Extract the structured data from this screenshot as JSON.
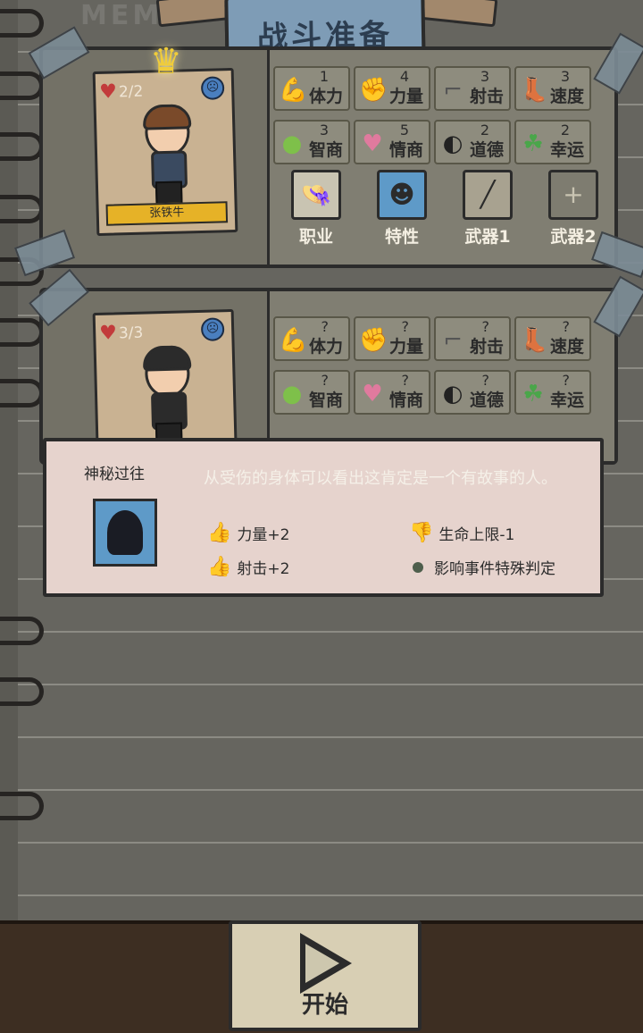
{
  "title": "战斗准备",
  "characters": [
    {
      "hp": "2/2",
      "name": "张铁牛",
      "stats": [
        {
          "label": "体力",
          "value": "1"
        },
        {
          "label": "力量",
          "value": "4"
        },
        {
          "label": "射击",
          "value": "3"
        },
        {
          "label": "速度",
          "value": "3"
        },
        {
          "label": "智商",
          "value": "3"
        },
        {
          "label": "情商",
          "value": "5"
        },
        {
          "label": "道德",
          "value": "2"
        },
        {
          "label": "幸运",
          "value": "2"
        }
      ],
      "slots": [
        {
          "label": "职业"
        },
        {
          "label": "特性"
        },
        {
          "label": "武器1"
        },
        {
          "label": "武器2"
        }
      ]
    },
    {
      "hp": "3/3",
      "stats": [
        {
          "label": "体力",
          "value": "?"
        },
        {
          "label": "力量",
          "value": "?"
        },
        {
          "label": "射击",
          "value": "?"
        },
        {
          "label": "速度",
          "value": "?"
        },
        {
          "label": "智商",
          "value": "?"
        },
        {
          "label": "情商",
          "value": "?"
        },
        {
          "label": "道德",
          "value": "?"
        },
        {
          "label": "幸运",
          "value": "?"
        }
      ]
    }
  ],
  "tooltip": {
    "title": "神秘过往",
    "description": "从受伤的身体可以看出这肯定是一个有故事的人。",
    "effects": [
      {
        "text": "力量+2",
        "type": "positive"
      },
      {
        "text": "射击+2",
        "type": "positive"
      },
      {
        "text": "生命上限-1",
        "type": "negative"
      },
      {
        "text": "影响事件特殊判定",
        "type": "neutral"
      }
    ]
  },
  "start_label": "开始"
}
